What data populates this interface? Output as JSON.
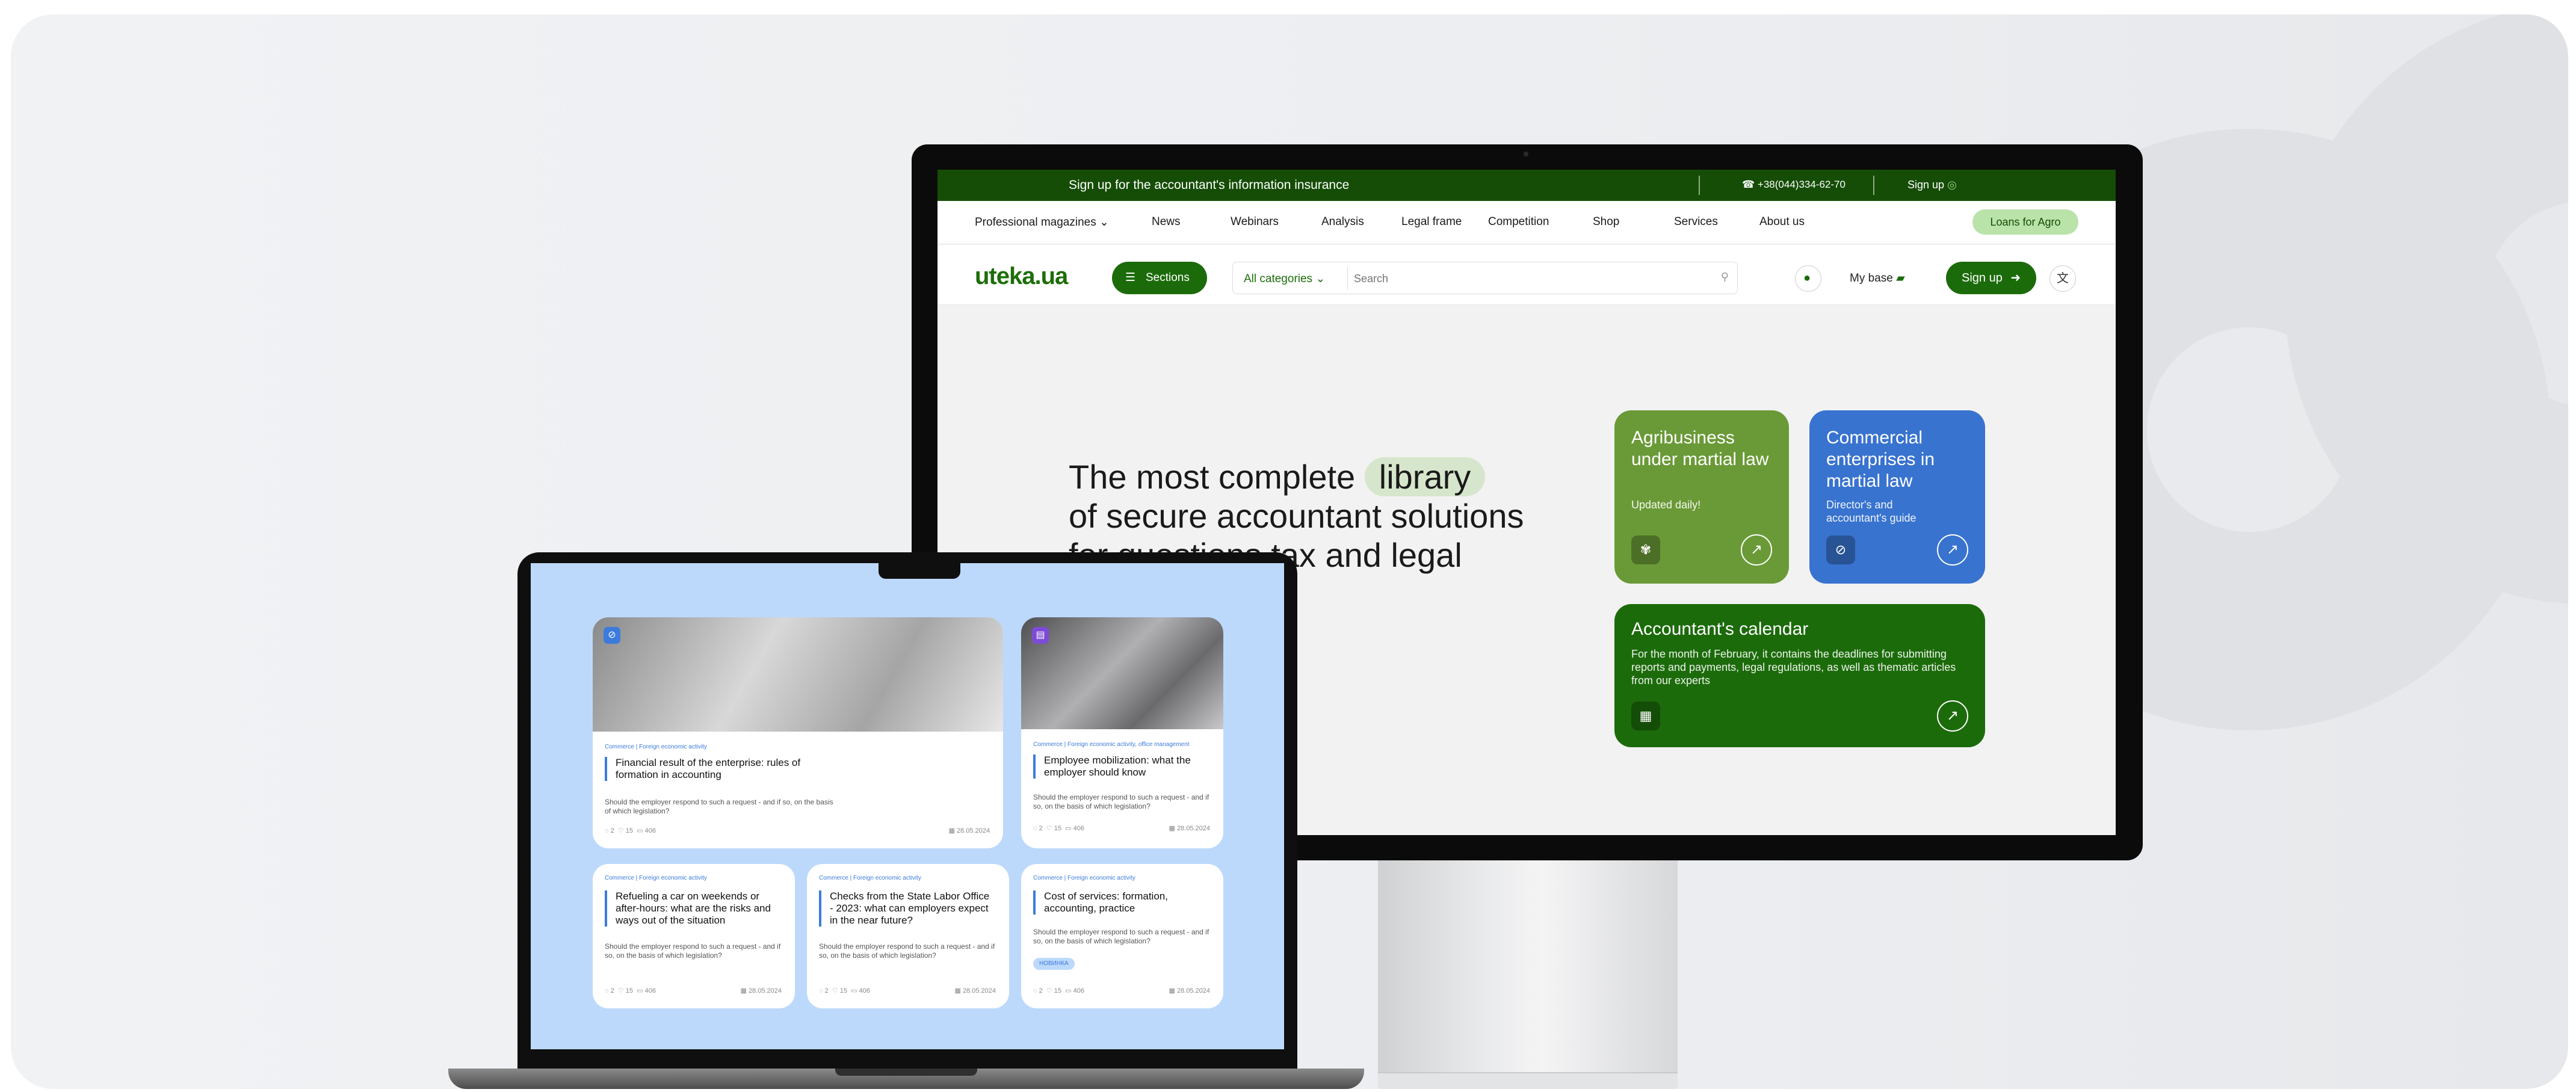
{
  "monitor": {
    "topbar": {
      "promo": "Sign up for the accountant's information insurance",
      "phone": "+38(044)334-62-70",
      "sign_up": "Sign up"
    },
    "nav": {
      "items": [
        "Professional magazines",
        "News",
        "Webinars",
        "Analysis",
        "Legal frame",
        "Competition",
        "Shop",
        "Services",
        "About us"
      ],
      "cta": "Loans for Agro"
    },
    "header": {
      "logo": "uteka.ua",
      "sections": "Sections",
      "category": "All categories",
      "search_placeholder": "Search",
      "my_base": "My base",
      "sign_up": "Sign up"
    },
    "hero": {
      "line1": "The most complete",
      "highlight": "library",
      "line2": "of secure accountant solutions",
      "line3": "for questions tax and legal"
    },
    "cards": [
      {
        "title": "Agribusiness under martial law",
        "subtitle": "Updated daily!",
        "color": "#6a9a37"
      },
      {
        "title": "Commercial enterprises in martial law",
        "subtitle": "Director's and accountant's guide",
        "color": "#3873cf"
      },
      {
        "title": "Accountant's calendar",
        "subtitle": "For the month of February, it contains the deadlines for submitting reports and payments, legal regulations, as well as thematic articles from our experts",
        "color": "#1c6b0b"
      }
    ]
  },
  "laptop": {
    "articles": [
      {
        "tag": "Commerce | Foreign economic activity",
        "title": "Financial result of the enterprise: rules of formation in accounting",
        "desc": "Should the employer respond to such a request - and if so, on the basis of which legislation?",
        "comments": "2",
        "likes": "15",
        "views": "406",
        "date": "28.05.2024"
      },
      {
        "tag": "Commerce | Foreign economic activity, office management",
        "title": "Employee mobilization: what the employer should know",
        "desc": "Should the employer respond to such a request - and if so, on the basis of which legislation?",
        "comments": "2",
        "likes": "15",
        "views": "406",
        "date": "28.05.2024"
      },
      {
        "tag": "Commerce | Foreign economic activity",
        "title": "Refueling a car on weekends or after-hours: what are the risks and ways out of the situation",
        "desc": "Should the employer respond to such a request - and if so, on the basis of which legislation?",
        "comments": "2",
        "likes": "15",
        "views": "406",
        "date": "28.05.2024"
      },
      {
        "tag": "Commerce | Foreign economic activity",
        "title": "Checks from the State Labor Office - 2023: what can employers expect in the near future?",
        "desc": "Should the employer respond to such a request - and if so, on the basis of which legislation?",
        "comments": "2",
        "likes": "15",
        "views": "406",
        "date": "28.05.2024"
      },
      {
        "tag": "Commerce | Foreign economic activity",
        "title": "Cost of services: formation, accounting, practice",
        "desc": "Should the employer respond to such a request - and if so, on the basis of which legislation?",
        "badge": "НОВИНКА",
        "comments": "2",
        "likes": "15",
        "views": "406",
        "date": "28.05.2024"
      }
    ]
  }
}
